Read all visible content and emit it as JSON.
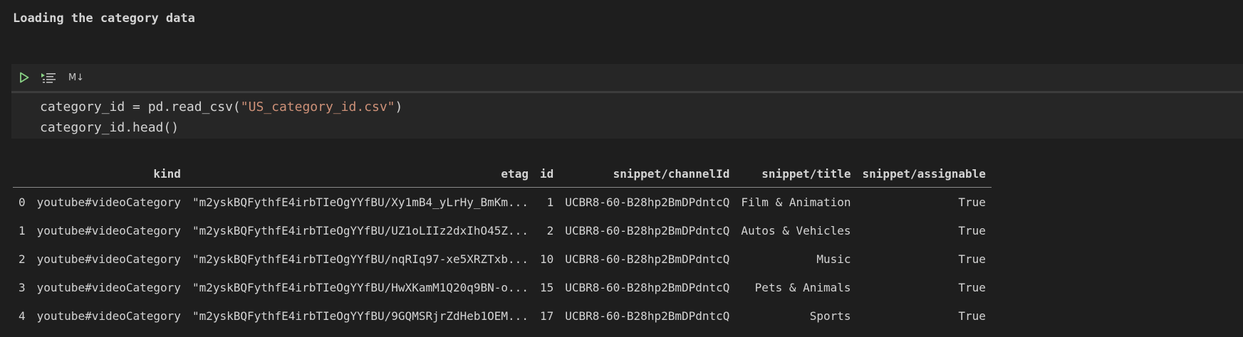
{
  "markdown": {
    "heading": "Loading the category data"
  },
  "cell": {
    "toolbar": {
      "run_icon": "run-icon",
      "run_above_icon": "run-by-line-icon",
      "markdown_toggle": "M↓"
    },
    "code": {
      "line1_prefix": "category_id = pd.read_csv(",
      "line1_string": "\"US_category_id.csv\"",
      "line1_suffix": ")",
      "line2": "category_id.head()"
    }
  },
  "output": {
    "columns": [
      "",
      "kind",
      "etag",
      "id",
      "snippet/channelId",
      "snippet/title",
      "snippet/assignable"
    ],
    "rows": [
      [
        "0",
        "youtube#videoCategory",
        "\"m2yskBQFythfE4irbTIeOgYYfBU/Xy1mB4_yLrHy_BmKm...",
        "1",
        "UCBR8-60-B28hp2BmDPdntcQ",
        "Film & Animation",
        "True"
      ],
      [
        "1",
        "youtube#videoCategory",
        "\"m2yskBQFythfE4irbTIeOgYYfBU/UZ1oLIIz2dxIhO45Z...",
        "2",
        "UCBR8-60-B28hp2BmDPdntcQ",
        "Autos & Vehicles",
        "True"
      ],
      [
        "2",
        "youtube#videoCategory",
        "\"m2yskBQFythfE4irbTIeOgYYfBU/nqRIq97-xe5XRZTxb...",
        "10",
        "UCBR8-60-B28hp2BmDPdntcQ",
        "Music",
        "True"
      ],
      [
        "3",
        "youtube#videoCategory",
        "\"m2yskBQFythfE4irbTIeOgYYfBU/HwXKamM1Q20q9BN-o...",
        "15",
        "UCBR8-60-B28hp2BmDPdntcQ",
        "Pets & Animals",
        "True"
      ],
      [
        "4",
        "youtube#videoCategory",
        "\"m2yskBQFythfE4irbTIeOgYYfBU/9GQMSRjrZdHeb1OEM...",
        "17",
        "UCBR8-60-B28hp2BmDPdntcQ",
        "Sports",
        "True"
      ]
    ]
  },
  "colors": {
    "background": "#1e1e1e",
    "cell_background": "#262626",
    "run_icon": "#89d185",
    "string_literal": "#ce9178"
  }
}
